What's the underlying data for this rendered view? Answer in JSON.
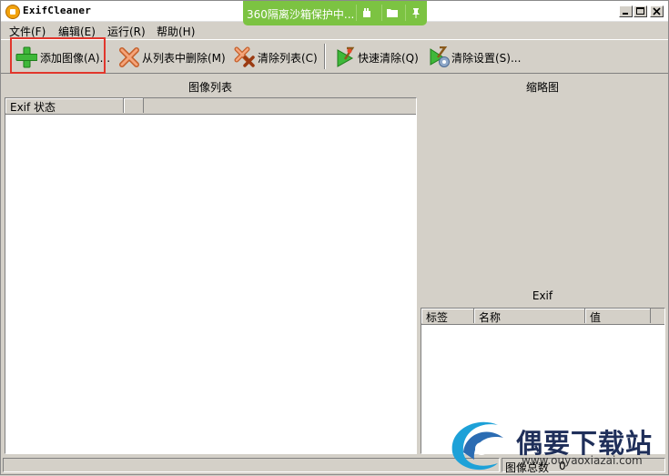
{
  "window": {
    "title": "ExifCleaner",
    "sandbox_label": "360隔离沙箱保护中..."
  },
  "menu": [
    {
      "label": "文件(F)"
    },
    {
      "label": "编辑(E)"
    },
    {
      "label": "运行(R)"
    },
    {
      "label": "帮助(H)"
    }
  ],
  "toolbar": {
    "add_image": "添加图像(A)...",
    "remove_from_list": "从列表中删除(M)",
    "clear_list": "清除列表(C)",
    "quick_clean": "快速清除(Q)",
    "clean_settings": "清除设置(S)..."
  },
  "image_list": {
    "title": "图像列表",
    "columns": [
      "Exif 状态",
      ""
    ]
  },
  "thumbnail": {
    "title": "缩略图"
  },
  "exif": {
    "title": "Exif",
    "columns": [
      "标签",
      "名称",
      "值"
    ]
  },
  "statusbar": {
    "total_label": "图像总数",
    "total_value": "0"
  },
  "watermark": {
    "brand": "偶要下载站",
    "url": "www.ouyaoxiazai.com"
  },
  "colors": {
    "highlight": "#e1362c",
    "sandbox": "#7cc342",
    "background": "#d4d0c8"
  }
}
